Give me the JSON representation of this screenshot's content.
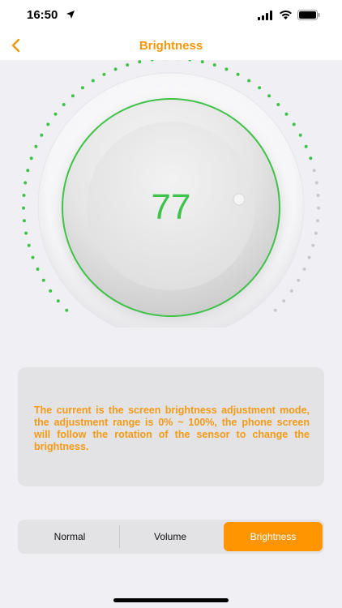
{
  "status_bar": {
    "time": "16:50",
    "location_icon": "location-arrow-icon",
    "signal_icon": "cellular-signal-icon",
    "wifi_icon": "wifi-icon",
    "battery_icon": "battery-icon"
  },
  "nav": {
    "title": "Brightness",
    "back_icon": "chevron-left-icon",
    "accent_color": "#f7960a"
  },
  "dial": {
    "value": "77",
    "active_color": "#3fc24a",
    "inactive_color": "#c8c8cc",
    "level_percent": 77
  },
  "info": {
    "text": "The current is the screen brightness adjustment mode, the adjustment range is 0% ~ 100%, the phone screen will follow the rotation of the sensor to change the brightness.",
    "text_color": "#f39a16"
  },
  "modes": {
    "items": [
      "Normal",
      "Volume",
      "Brightness"
    ],
    "selected": "Brightness",
    "selected_color": "#ff9500"
  }
}
